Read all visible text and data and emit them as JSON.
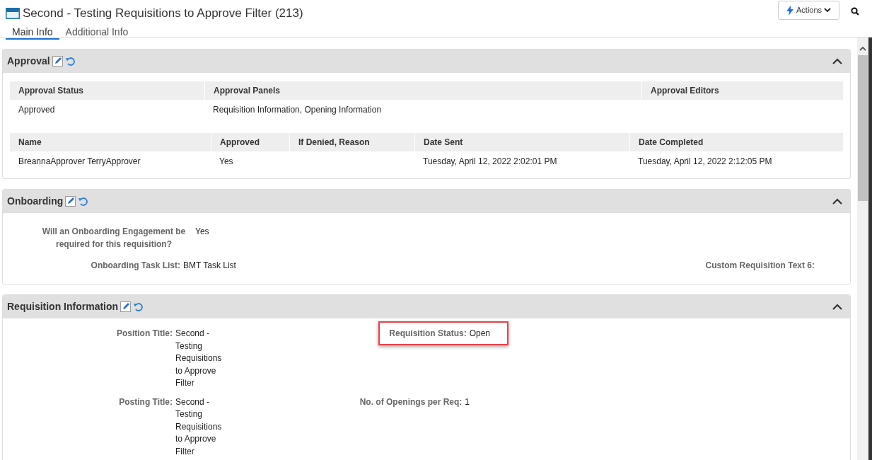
{
  "header": {
    "title": "Second - Testing Requisitions to Approve Filter (213)",
    "actions_label": "Actions"
  },
  "tabs": [
    {
      "label": "Main Info",
      "selected": true
    },
    {
      "label": "Additional Info",
      "selected": false
    }
  ],
  "sections": [
    {
      "kind": "tables",
      "title": "Approval",
      "expanded": true,
      "tables": [
        {
          "columns": [
            "Approval Status",
            "Approval Panels",
            "Approval Editors"
          ],
          "rows": [
            [
              "Approved",
              "Requisition Information, Opening Information",
              ""
            ]
          ]
        },
        {
          "columns": [
            "Name",
            "Approved",
            "If Denied, Reason",
            "Date Sent",
            "Date Completed"
          ],
          "rows": [
            [
              "BreannaApprover TerryApprover",
              "Yes",
              "",
              "Tuesday, April 12, 2022 2:02:01 PM",
              "Tuesday, April 12, 2022 2:12:05 PM"
            ]
          ]
        }
      ]
    },
    {
      "kind": "onboarding",
      "title": "Onboarding",
      "expanded": true,
      "rows": [
        {
          "left": {
            "label": "Will an Onboarding Engagement be required for this requisition?",
            "value": "Yes"
          }
        },
        {
          "left": {
            "label": "Onboarding Task List:",
            "value": "BMT Task List"
          },
          "right": {
            "label": "Custom Requisition Text 6:"
          }
        }
      ]
    },
    {
      "kind": "details",
      "title": "Requisition Information",
      "expanded": true,
      "rows": [
        {
          "left": {
            "label": "Position Title:",
            "value": "Second - Testing Requisitions to Approve Filter"
          },
          "right": {
            "label": "Requisition Status:",
            "value": "Open",
            "highlighted": true
          }
        },
        {
          "left": {
            "label": "Posting Title:",
            "value": "Second - Testing Requisitions to Approve Filter"
          },
          "right": {
            "label": "No. of Openings per Req:",
            "value": "1",
            "highlighted": false
          }
        }
      ]
    }
  ]
}
